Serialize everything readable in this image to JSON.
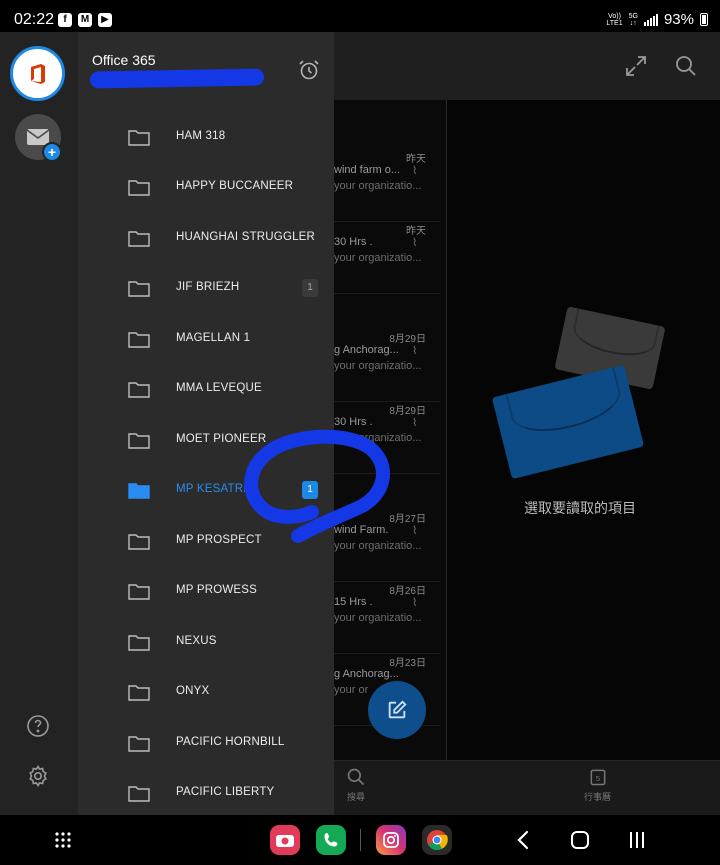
{
  "status_bar": {
    "time": "02:22",
    "net_line1": "Vo))",
    "net_line2": "LTE1",
    "net_5g_line1": "5G",
    "net_5g_line2": "↓↑",
    "battery_percent": "93%"
  },
  "account": {
    "name": "Office 365",
    "email": "xxxxxxxxxxxxxxx"
  },
  "folders": [
    {
      "label": "HAM 318",
      "badge": "",
      "selected": false
    },
    {
      "label": "HAPPY BUCCANEER",
      "badge": "",
      "selected": false
    },
    {
      "label": "HUANGHAI STRUGGLER",
      "badge": "",
      "selected": false
    },
    {
      "label": "JIF BRIEZH",
      "badge": "1",
      "selected": false
    },
    {
      "label": "MAGELLAN 1",
      "badge": "",
      "selected": false
    },
    {
      "label": "MMA LEVEQUE",
      "badge": "",
      "selected": false
    },
    {
      "label": "MOET PIONEER",
      "badge": "",
      "selected": false
    },
    {
      "label": "MP KESATRIA",
      "badge": "1",
      "selected": true
    },
    {
      "label": "MP PROSPECT",
      "badge": "",
      "selected": false
    },
    {
      "label": "MP PROWESS",
      "badge": "",
      "selected": false
    },
    {
      "label": "NEXUS",
      "badge": "",
      "selected": false
    },
    {
      "label": "ONYX",
      "badge": "",
      "selected": false
    },
    {
      "label": "PACIFIC HORNBILL",
      "badge": "",
      "selected": false
    },
    {
      "label": "PACIFIC LIBERTY",
      "badge": "",
      "selected": false
    }
  ],
  "mail_list": [
    {
      "date": "昨天",
      "subject": "wind farm o...",
      "preview": "your organizatio..."
    },
    {
      "date": "昨天",
      "subject": "30 Hrs .",
      "preview": "your organizatio..."
    },
    {
      "date": "8月29日",
      "subject": "g Anchorag...",
      "preview": "your organizatio..."
    },
    {
      "date": "8月29日",
      "subject": "30 Hrs .",
      "preview": "your organizatio..."
    },
    {
      "date": "8月27日",
      "subject": "wind Farm.",
      "preview": "your organizatio..."
    },
    {
      "date": "8月26日",
      "subject": "15 Hrs .",
      "preview": "your organizatio..."
    },
    {
      "date": "8月23日",
      "subject": "g Anchorag...",
      "preview": "your or"
    }
  ],
  "reading_pane": {
    "empty_text": "選取要讀取的項目"
  },
  "bottom_bar": {
    "search_label": "搜尋",
    "calendar_label": "行事曆",
    "calendar_day": "5"
  },
  "colors": {
    "accent": "#1e88e5",
    "selected_text": "#2a8cf0",
    "drawer_bg": "#2b2b2b",
    "rail_bg": "#232323",
    "annotation": "#1538e6"
  }
}
